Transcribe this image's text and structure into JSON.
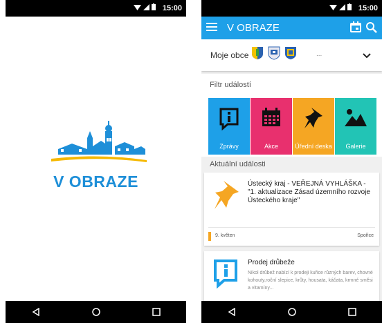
{
  "status_bar": {
    "time": "15:00"
  },
  "splash": {
    "app_name": "V OBRAZE"
  },
  "app_bar": {
    "title": "V OBRAZE"
  },
  "municipalities": {
    "label": "Moje obce",
    "more": "..."
  },
  "filter": {
    "heading": "Filtr událostí",
    "tiles": [
      {
        "label": "Zprávy",
        "icon": "info-icon",
        "color": "#1ea0e8"
      },
      {
        "label": "Akce",
        "icon": "calendar-icon",
        "color": "#e8306e"
      },
      {
        "label": "Úřední deska",
        "icon": "pin-icon",
        "color": "#f5a623"
      },
      {
        "label": "Galerie",
        "icon": "image-icon",
        "color": "#22c4b5"
      }
    ]
  },
  "events": {
    "heading": "Aktuální události",
    "items": [
      {
        "title": "Ústecký kraj - VEŘEJNÁ VYHLÁŠKA - \"1. aktualizace Zásad územního rozvoje Ústeckého kraje\"",
        "icon": "pin-icon",
        "date": "9. květen",
        "place": "Spořice"
      },
      {
        "title": "Prodej drůbeže",
        "description": "Nikol drůbež nabízí k prodeji kuřice různých barev, chovné kohouty,roční slepice, krůty, housata, káčata, krmné směsi a vitamíny...",
        "icon": "info-icon"
      }
    ]
  },
  "colors": {
    "primary": "#1ea0e8",
    "accent_orange": "#f5a623",
    "accent_pink": "#e8306e",
    "accent_teal": "#22c4b5"
  }
}
